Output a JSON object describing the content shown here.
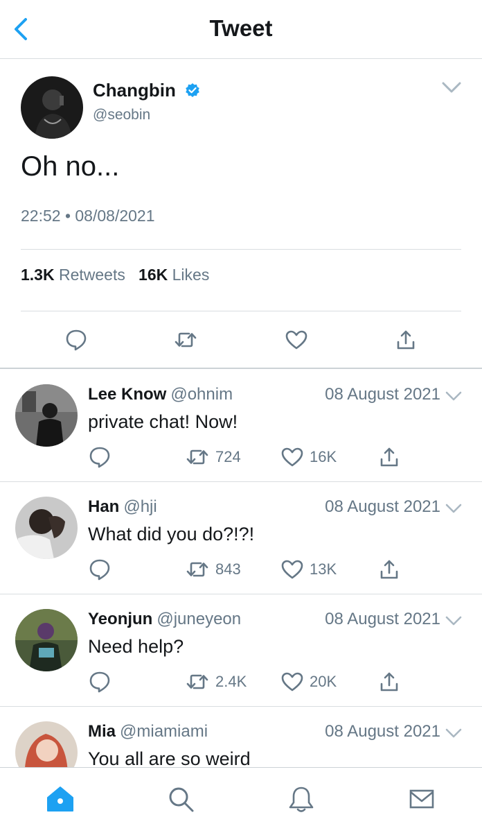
{
  "header": {
    "title": "Tweet"
  },
  "tweet": {
    "author_name": "Changbin",
    "author_handle": "@seobin",
    "text": "Oh no...",
    "timestamp": "22:52 • 08/08/2021",
    "retweets_count": "1.3K",
    "retweets_label": "Retweets",
    "likes_count": "16K",
    "likes_label": "Likes"
  },
  "replies": [
    {
      "name": "Lee Know",
      "handle": "@ohnim",
      "date": "08 August 2021",
      "text": "private chat! Now!",
      "retweets": "724",
      "likes": "16K"
    },
    {
      "name": "Han",
      "handle": "@hji",
      "date": "08 August 2021",
      "text": "What did you do?!?!",
      "retweets": "843",
      "likes": "13K"
    },
    {
      "name": "Yeonjun",
      "handle": "@juneyeon",
      "date": "08 August 2021",
      "text": "Need help?",
      "retweets": "2.4K",
      "likes": "20K"
    },
    {
      "name": "Mia",
      "handle": "@miamiami",
      "date": "08 August 2021",
      "text": "You all are so weird"
    }
  ],
  "tab_bar": {
    "icons": [
      "home-icon",
      "search-icon",
      "bell-icon",
      "mail-icon"
    ]
  },
  "colors": {
    "accent": "#1da1f2",
    "text": "#14171a",
    "secondary": "#657786",
    "divider": "#d9dde0"
  }
}
